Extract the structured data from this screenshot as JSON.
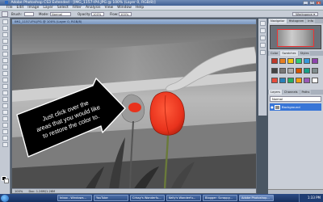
{
  "app": {
    "title": "Adobe Photoshop CS3 Extended - [IMG_1157-IP4.JPG @ 100% (Layer 0, RGB/8)]",
    "icon": "photoshop-icon"
  },
  "window_controls": {
    "minimize": "_",
    "maximize": "□",
    "close": "x"
  },
  "menu": [
    "File",
    "Edit",
    "Image",
    "Layer",
    "Select",
    "Filter",
    "Analysis",
    "View",
    "Window",
    "Help"
  ],
  "options_bar": {
    "brush_label": "Brush:",
    "mode_label": "Mode:",
    "mode_value": "Normal",
    "opacity_label": "Opacity:",
    "opacity_value": "100%",
    "flow_label": "Flow:",
    "flow_value": "100%",
    "workspace_label": "Workspace ▾"
  },
  "document": {
    "title": "IMG_1157-IP4.JPG @ 100% (Layer 0, RGB/8)",
    "zoom": "100%",
    "status": "Doc: 1.26M/1.26M"
  },
  "annotation": {
    "text_line1": "Just click over the",
    "text_line2": "areas that you would like",
    "text_line3": "to restore the color to."
  },
  "panels": {
    "top_tabs": [
      "Navigator",
      "Histogram",
      "Info"
    ],
    "mid_tabs": [
      "Color",
      "Swatches",
      "Styles"
    ],
    "layers_tabs": [
      "Layers",
      "Channels",
      "Paths"
    ],
    "blend_mode": "Normal",
    "layer_name": "Background"
  },
  "swatch_colors": [
    "#c0392b",
    "#e67e22",
    "#f1c40f",
    "#2ecc71",
    "#3498db",
    "#8e44ad",
    "#444444",
    "#777777",
    "#aaaaaa",
    "#d35400",
    "#16a085",
    "#7f8c8d",
    "#e74c3c",
    "#2980b9",
    "#27ae60",
    "#f39c12",
    "#9b59b6",
    "#ffffff"
  ],
  "taskbar": {
    "tasks": [
      "Inbox - Windows...",
      "YouTube",
      "Crissy's Wonderfu...",
      "Kelly's Wonderfu...",
      "Blogger: Scrappy...",
      "Adobe Photoshop..."
    ],
    "time": "1:33 PM"
  },
  "colors": {
    "tulip_red": "#e8321c",
    "canvas_gray": "#8a8a8a",
    "selection_blue": "#3875d7"
  }
}
